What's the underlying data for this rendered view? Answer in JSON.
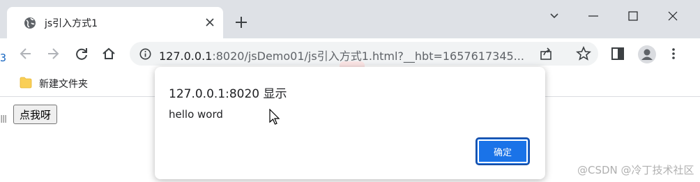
{
  "browser": {
    "tab": {
      "title": "js引入方式1"
    },
    "address": {
      "host": "127.0.0.1",
      "path": ":8020/jsDemo01/js引入方式1.html?__hbt=1657617345..."
    },
    "bookmarks": [
      {
        "label": "新建文件夹"
      }
    ]
  },
  "page": {
    "button_label": "点我呀"
  },
  "dialog": {
    "title": "127.0.0.1:8020 显示",
    "message": "hello word",
    "ok_label": "确定"
  },
  "watermark": "@CSDN @冷丁技术社区",
  "colors": {
    "accent": "#1a73e8",
    "titlebar": "#dee1e6",
    "omnibox": "#f1f3f4"
  }
}
